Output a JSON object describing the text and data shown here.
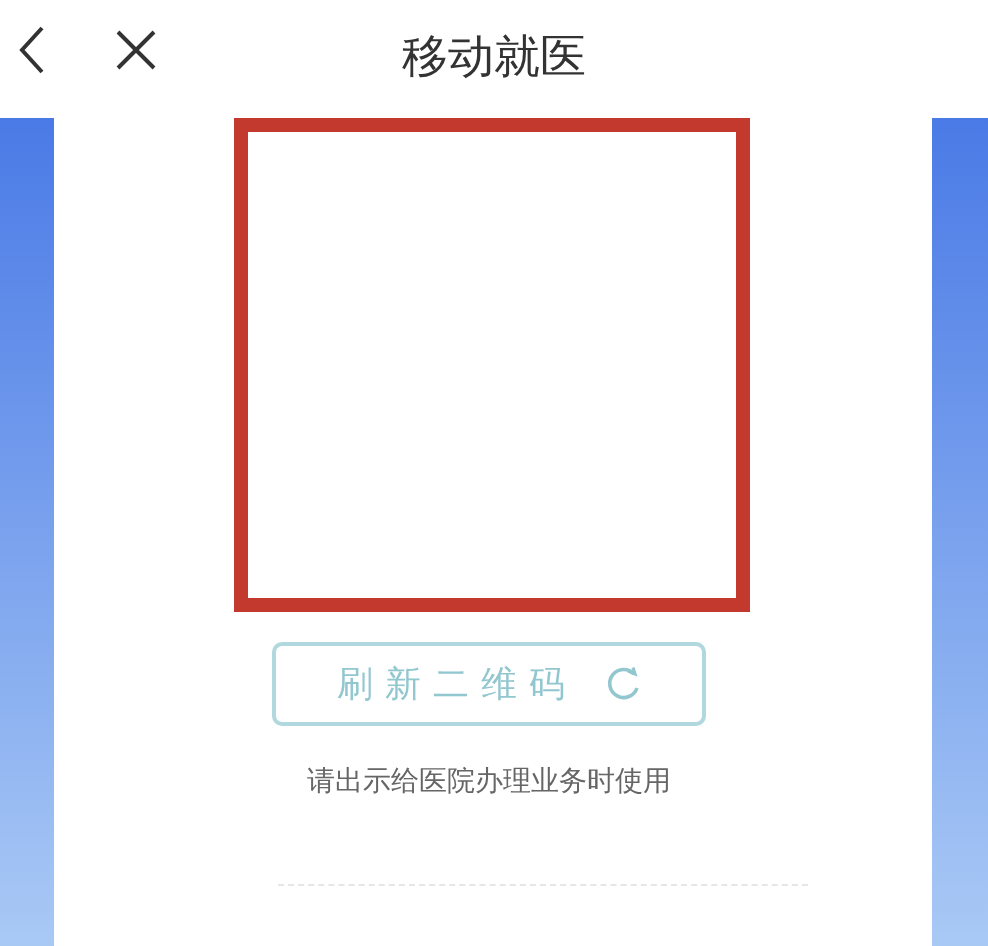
{
  "window": {
    "title": "移动就医"
  },
  "card": {
    "refresh_button": {
      "label": "刷新二维码"
    },
    "hint": "请出示给医院办理业务时使用"
  }
}
